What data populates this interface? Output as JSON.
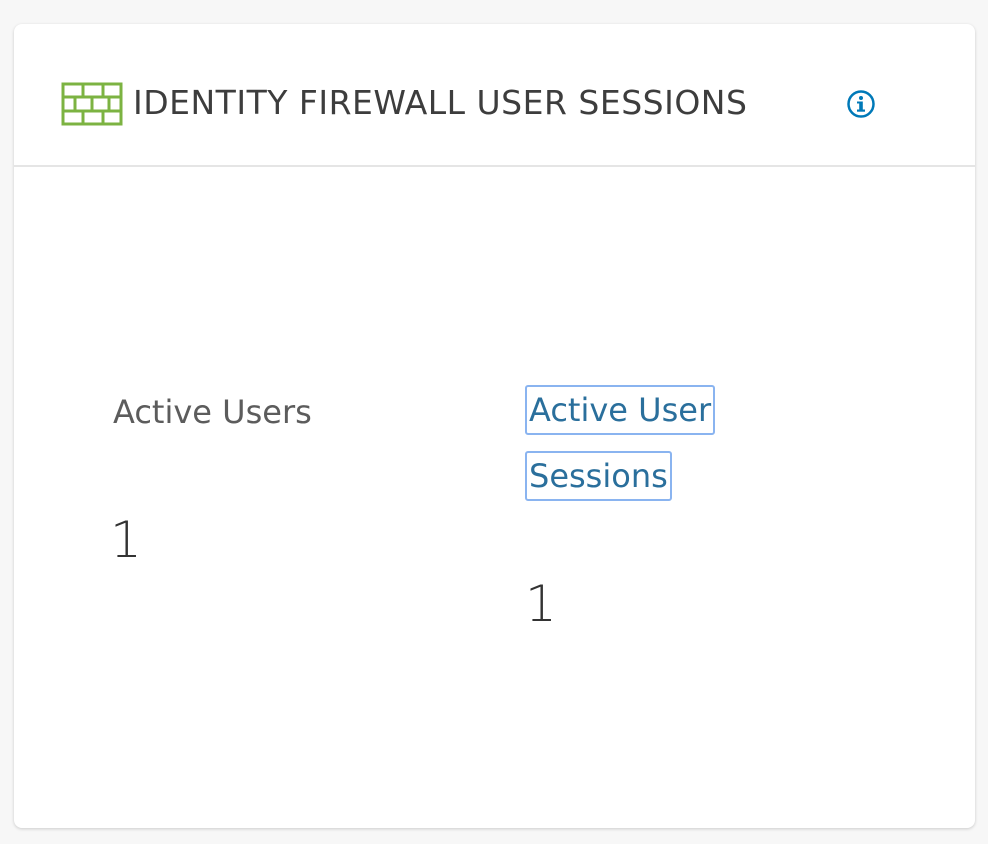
{
  "widget": {
    "title": "IDENTITY FIREWALL USER SESSIONS",
    "header_icon": "firewall-icon",
    "info_icon": "info-icon",
    "icon_color": "#7cb342",
    "info_color": "#0079b8"
  },
  "metrics": {
    "active_users": {
      "label": "Active Users",
      "value": "1"
    },
    "active_user_sessions": {
      "label_line1": "Active User",
      "label_line2": "Sessions",
      "value": "1",
      "link_color": "#2a6f9c"
    }
  }
}
